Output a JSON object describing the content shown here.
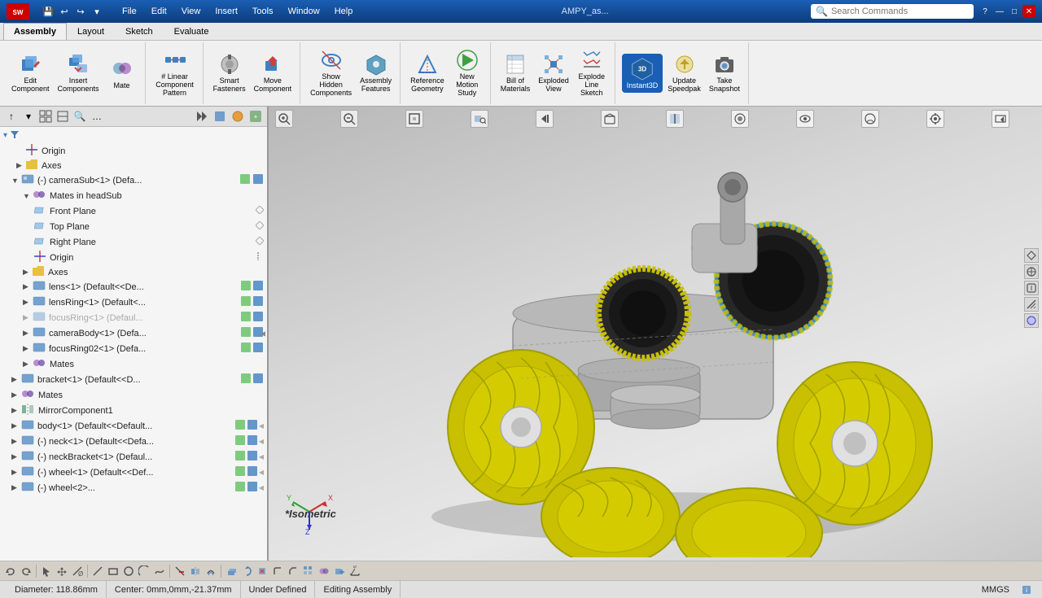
{
  "titlebar": {
    "logo": "SW",
    "menus": [
      "File",
      "Edit",
      "View",
      "Insert",
      "Tools",
      "Window",
      "Help"
    ],
    "filename": "AMPY_as...",
    "search_placeholder": "Search Commands",
    "win_buttons": [
      "?",
      "—",
      "□",
      "✕"
    ]
  },
  "ribbon": {
    "tabs": [
      "Assembly",
      "Layout",
      "Sketch",
      "Evaluate"
    ],
    "active_tab": "Assembly",
    "groups": [
      {
        "label": "",
        "buttons": [
          {
            "id": "edit-component",
            "label": "Edit\nComponent",
            "icon": "✏️"
          },
          {
            "id": "insert-components",
            "label": "Insert\nComponents",
            "icon": "📦"
          },
          {
            "id": "mate",
            "label": "Mate",
            "icon": "🔗"
          }
        ]
      },
      {
        "label": "# Linear Component Pattern",
        "buttons": [
          {
            "id": "linear-pattern",
            "label": "Linear\nComponent\nPattern",
            "icon": "⊞"
          }
        ]
      },
      {
        "label": "",
        "buttons": [
          {
            "id": "smart-fasteners",
            "label": "Smart\nFasteners",
            "icon": "🔩"
          },
          {
            "id": "move-component",
            "label": "Move\nComponent",
            "icon": "↗"
          }
        ]
      },
      {
        "label": "Assembly Features",
        "buttons": [
          {
            "id": "show-hidden",
            "label": "Show\nHidden\nComponents",
            "icon": "👁"
          },
          {
            "id": "assembly-features",
            "label": "Assembly\nFeatures",
            "icon": "⚙"
          }
        ]
      },
      {
        "label": "Reference Geometry",
        "buttons": [
          {
            "id": "reference-geometry",
            "label": "Reference\nGeometry",
            "icon": "📐"
          },
          {
            "id": "new-motion",
            "label": "New\nMotion\nStudy",
            "icon": "▶"
          }
        ]
      },
      {
        "label": "Bill of Materials",
        "buttons": [
          {
            "id": "bill-of-materials",
            "label": "Bill of\nMaterials",
            "icon": "📋"
          },
          {
            "id": "exploded-view",
            "label": "Exploded\nView",
            "icon": "💥"
          },
          {
            "id": "explode-line",
            "label": "Explode\nLine\nSketch",
            "icon": "✒"
          }
        ]
      },
      {
        "label": "",
        "buttons": [
          {
            "id": "instant3d",
            "label": "Instant3D",
            "icon": "3D",
            "active": true
          },
          {
            "id": "update-speedpak",
            "label": "Update\nSpeedpak",
            "icon": "⚡"
          },
          {
            "id": "take-snapshot",
            "label": "Take\nSnapshot",
            "icon": "📷"
          }
        ]
      }
    ]
  },
  "feature_tree": {
    "toolbar_buttons": [
      "↑",
      "▾",
      "⊞",
      "⊡",
      "🔍",
      "…"
    ],
    "items": [
      {
        "id": "root",
        "label": "",
        "indent": 0,
        "type": "root",
        "expanded": true
      },
      {
        "id": "origin",
        "label": "Origin",
        "indent": 1,
        "type": "origin",
        "expanded": false
      },
      {
        "id": "axes",
        "label": "Axes",
        "indent": 1,
        "type": "folder",
        "expanded": false
      },
      {
        "id": "camera-sub",
        "label": "(-) cameraSub<1> (Defa...",
        "indent": 1,
        "type": "assembly",
        "expanded": true,
        "has_actions": true
      },
      {
        "id": "mates-in-head",
        "label": "Mates in headSub",
        "indent": 2,
        "type": "mates",
        "expanded": true
      },
      {
        "id": "front-plane",
        "label": "Front Plane",
        "indent": 3,
        "type": "plane"
      },
      {
        "id": "top-plane",
        "label": "Top Plane",
        "indent": 3,
        "type": "plane"
      },
      {
        "id": "right-plane",
        "label": "Right Plane",
        "indent": 3,
        "type": "plane"
      },
      {
        "id": "origin2",
        "label": "Origin",
        "indent": 3,
        "type": "origin"
      },
      {
        "id": "axes2",
        "label": "Axes",
        "indent": 2,
        "type": "folder",
        "expanded": false
      },
      {
        "id": "lens1",
        "label": "lens<1> (Default<<De...",
        "indent": 2,
        "type": "part",
        "expanded": false,
        "has_actions": true
      },
      {
        "id": "lensring1",
        "label": "lensRing<1> (Default<...",
        "indent": 2,
        "type": "part",
        "expanded": false,
        "has_actions": true
      },
      {
        "id": "focusring1",
        "label": "focusRing<1> (Defaul...",
        "indent": 2,
        "type": "part_suppressed",
        "expanded": false,
        "has_actions": true
      },
      {
        "id": "camerabody1",
        "label": "cameraBody<1> (Defa...",
        "indent": 2,
        "type": "part",
        "expanded": false,
        "has_actions": true
      },
      {
        "id": "focusring02",
        "label": "focusRing02<1> (Defa...",
        "indent": 2,
        "type": "part",
        "expanded": false,
        "has_actions": true
      },
      {
        "id": "mates1",
        "label": "Mates",
        "indent": 2,
        "type": "mates"
      },
      {
        "id": "bracket1",
        "label": "bracket<1> (Default<<D...",
        "indent": 1,
        "type": "part",
        "expanded": false,
        "has_actions": true
      },
      {
        "id": "mates2",
        "label": "Mates",
        "indent": 1,
        "type": "mates"
      },
      {
        "id": "mirrorcomponent1",
        "label": "MirrorComponent1",
        "indent": 1,
        "type": "mirror"
      },
      {
        "id": "body1",
        "label": "body<1> (Default<<Default...",
        "indent": 1,
        "type": "part",
        "expanded": false,
        "has_actions": true
      },
      {
        "id": "neck1",
        "label": "(-) neck<1> (Default<<Defa...",
        "indent": 1,
        "type": "part",
        "expanded": false,
        "has_actions": true
      },
      {
        "id": "neckbracket1",
        "label": "(-) neckBracket<1> (Defaul...",
        "indent": 1,
        "type": "part",
        "expanded": false,
        "has_actions": true
      },
      {
        "id": "wheel1",
        "label": "(-) wheel<1> (Default<<Def...",
        "indent": 1,
        "type": "part",
        "expanded": false,
        "has_actions": true
      },
      {
        "id": "wheel2",
        "label": "(-) wheel<2>...",
        "indent": 1,
        "type": "part",
        "expanded": false,
        "has_actions": true
      }
    ]
  },
  "viewport": {
    "view_label": "*Isometric",
    "toolbar_buttons": [
      "🔍+",
      "🔍-",
      "⊞",
      "⊡",
      "⬜",
      "🔷",
      "💡",
      "🎨",
      "⚙"
    ],
    "right_buttons": [
      "↑",
      "↓",
      "←",
      "→",
      "⊙"
    ]
  },
  "statusbar": {
    "diameter": "Diameter: 118.86mm",
    "center": "Center: 0mm,0mm,-21.37mm",
    "state": "Under Defined",
    "mode": "Editing Assembly",
    "units": "MMGS"
  },
  "commandbar": {
    "buttons": [
      "↩",
      "↪",
      "⊕",
      "↗",
      "🖱",
      "⊞",
      "▲",
      "📐",
      "⊙",
      "✏",
      "⊡",
      "⬜",
      "⭕",
      "✒",
      "⬡",
      "📏",
      "🔗",
      "⬛",
      "◯",
      "♦",
      "⊹",
      "⊗",
      "⊞",
      "⋮",
      "⋯"
    ]
  }
}
